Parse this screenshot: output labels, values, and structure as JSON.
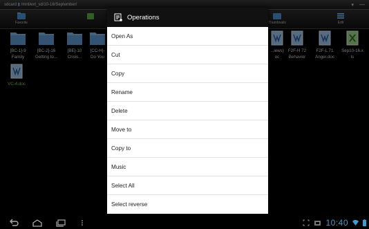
{
  "path_bar": {
    "root": "sdcard",
    "path": "/mnt/ext_sd/10-16/September/"
  },
  "toolbar": {
    "items": [
      {
        "label": "Favorite",
        "icon": "favorite-icon"
      },
      {
        "label": "",
        "icon": "home-icon"
      },
      {
        "label": "",
        "icon": "back-icon"
      },
      {
        "label": "Thumbnails",
        "icon": "thumbnail-icon"
      },
      {
        "label": "Edit",
        "icon": "edit-icon"
      }
    ]
  },
  "files": [
    {
      "line1": "[BC-1]-9",
      "line2": "Family",
      "type": "folder"
    },
    {
      "line1": "[BC-2]-16",
      "line2": "Getting to...",
      "type": "folder"
    },
    {
      "line1": "[BE]-10",
      "line2": "Crisis...",
      "type": "folder"
    },
    {
      "line1": "[CC-H]-",
      "line2": "Do You",
      "type": "folder"
    },
    {
      "line1": "...iews)",
      "line2": "oc",
      "type": "doc"
    },
    {
      "line1": "F2F-H 72",
      "line2": "Behavior",
      "type": "doc"
    },
    {
      "line1": "F2F-L 71",
      "line2": "Anger.doc",
      "type": "doc"
    },
    {
      "line1": "Sep10-16.x",
      "line2": "ls",
      "type": "xls"
    },
    {
      "line1": "VC-4.doc",
      "line2": "",
      "type": "doc",
      "highlight": true
    }
  ],
  "dialog": {
    "title": "Operations",
    "icon": "operations-icon",
    "items": [
      "Open As",
      "Cut",
      "Copy",
      "Rename",
      "Delete",
      "Move to",
      "Copy to",
      "Music",
      "Select All",
      "Select reverse"
    ]
  },
  "status": {
    "time": "10:40",
    "accent": "#3d9cd6"
  }
}
